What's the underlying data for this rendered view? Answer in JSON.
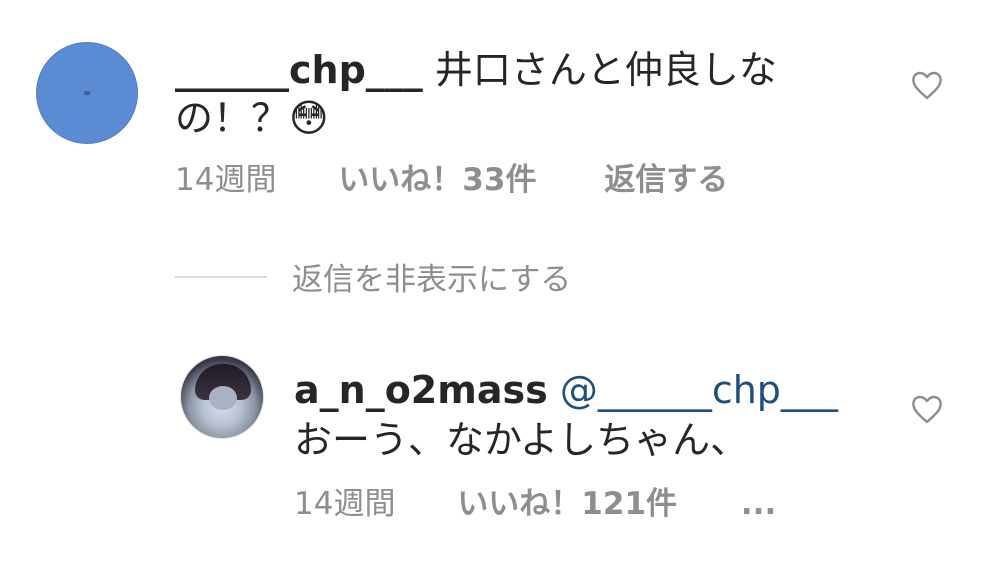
{
  "comment1": {
    "username": "______chp___",
    "text_line1": "井口さんと仲良しな",
    "text_line2": "の！？",
    "emoji": "😳",
    "time": "14週間",
    "likes": "いいね！33件",
    "reply": "返信する"
  },
  "replies_toggle": {
    "label": "返信を非表示にする"
  },
  "comment2": {
    "username": "a_n_o2mass",
    "mention": "@______chp___",
    "text": "おーう、なかよしちゃん、",
    "time": "14週間",
    "likes": "いいね！121件",
    "more": "..."
  },
  "icons": {
    "like": "heart-outline-icon",
    "more": "more-options-icon"
  }
}
